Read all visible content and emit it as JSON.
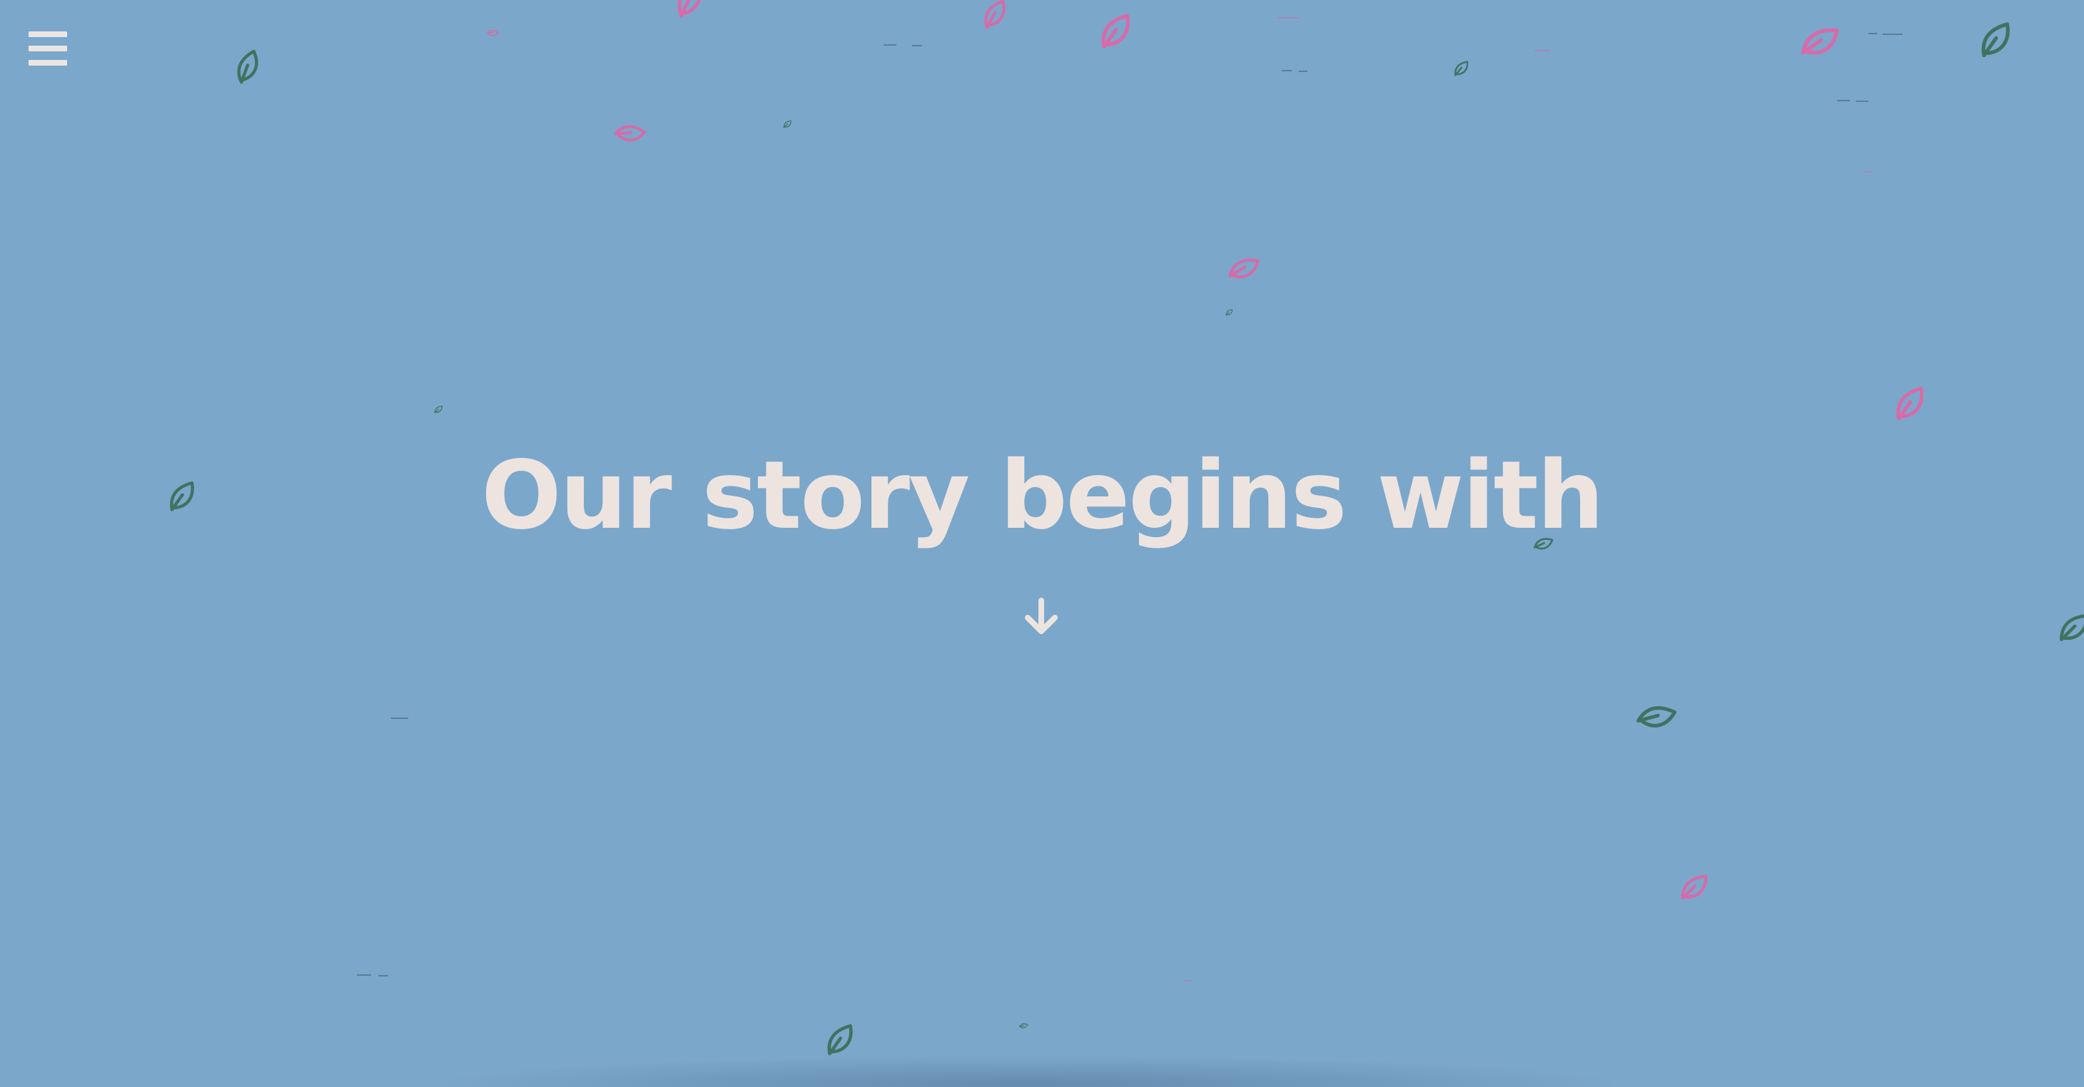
{
  "hero": {
    "title": "Our story begins with"
  },
  "navigation": {
    "menu_icon": "hamburger-menu-icon",
    "scroll_icon": "arrow-down-icon"
  },
  "colors": {
    "background": "#7ba7cb",
    "title_text": "#ede4e0",
    "leaf_green": "#3f7360",
    "leaf_pink": "#d86aa8"
  },
  "decorations": {
    "leaf_icon": "leaf-icon"
  }
}
